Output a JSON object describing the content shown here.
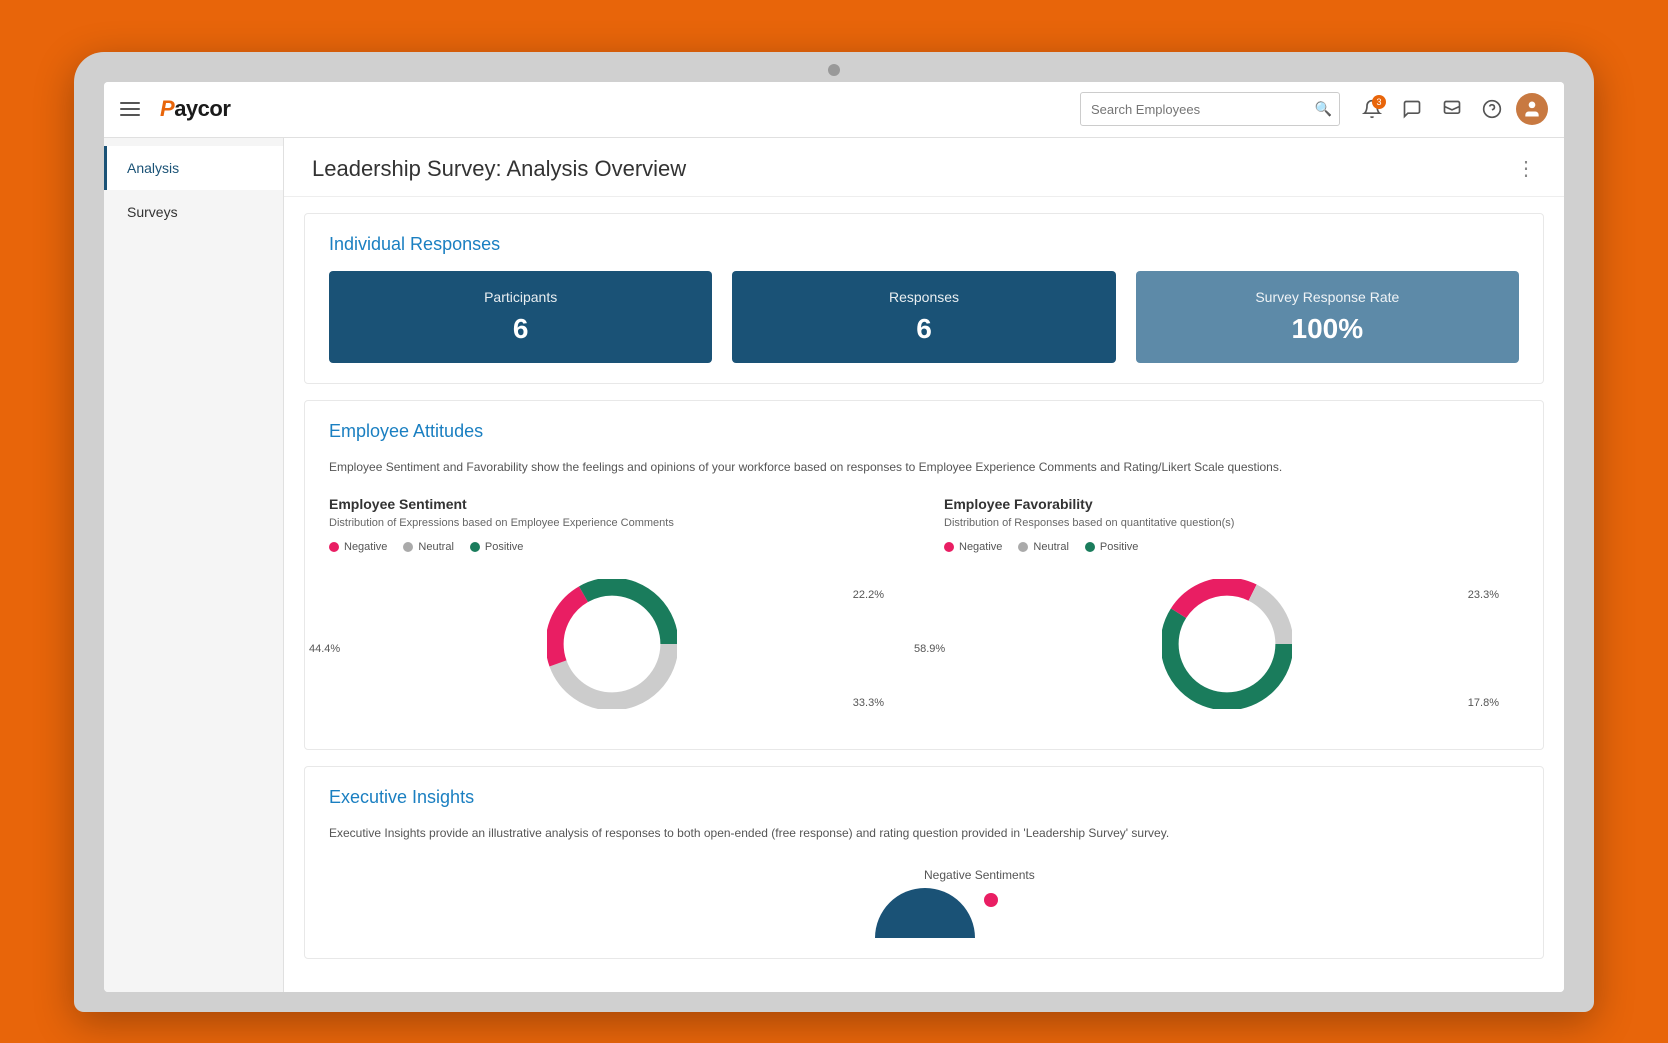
{
  "app": {
    "title": "Paycor"
  },
  "navbar": {
    "search_placeholder": "Search Employees",
    "notification_count": "3"
  },
  "sidebar": {
    "items": [
      {
        "label": "Analysis",
        "active": true
      },
      {
        "label": "Surveys",
        "active": false
      }
    ]
  },
  "page": {
    "title": "Leadership Survey: Analysis Overview"
  },
  "individual_responses": {
    "section_title": "Individual Responses",
    "stats": [
      {
        "label": "Participants",
        "value": "6",
        "type": "dark"
      },
      {
        "label": "Responses",
        "value": "6",
        "type": "dark"
      },
      {
        "label": "Survey Response Rate",
        "value": "100%",
        "type": "lighter"
      }
    ]
  },
  "employee_attitudes": {
    "section_title": "Employee Attitudes",
    "description": "Employee Sentiment and Favorability show the feelings and opinions of your workforce based on responses to Employee Experience Comments and Rating/Likert Scale questions.",
    "sentiment_chart": {
      "title": "Employee Sentiment",
      "subtitle": "Distribution of Expressions based on Employee Experience Comments",
      "legend": [
        {
          "label": "Negative",
          "color": "#e91e63"
        },
        {
          "label": "Neutral",
          "color": "#aaa"
        },
        {
          "label": "Positive",
          "color": "#1a7c5c"
        }
      ],
      "segments": [
        {
          "label": "44.4%",
          "value": 44.4,
          "color": "#aaa",
          "position": "left"
        },
        {
          "label": "22.2%",
          "value": 22.2,
          "color": "#e91e63",
          "position": "top-right"
        },
        {
          "label": "33.3%",
          "value": 33.3,
          "color": "#1a7c5c",
          "position": "bottom-right"
        }
      ]
    },
    "favorability_chart": {
      "title": "Employee Favorability",
      "subtitle": "Distribution of Responses based on quantitative question(s)",
      "legend": [
        {
          "label": "Negative",
          "color": "#e91e63"
        },
        {
          "label": "Neutral",
          "color": "#aaa"
        },
        {
          "label": "Positive",
          "color": "#1a7c5c"
        }
      ],
      "segments": [
        {
          "label": "58.9%",
          "value": 58.9,
          "color": "#1a7c5c",
          "position": "left"
        },
        {
          "label": "23.3%",
          "value": 23.3,
          "color": "#e91e63",
          "position": "top-right"
        },
        {
          "label": "17.8%",
          "value": 17.8,
          "color": "#aaa",
          "position": "bottom-right"
        }
      ]
    }
  },
  "executive_insights": {
    "section_title": "Executive Insights",
    "description": "Executive Insights provide an illustrative analysis of responses to both open-ended (free response) and rating question provided in 'Leadership Survey' survey.",
    "chart_label": "Negative Sentiments"
  }
}
